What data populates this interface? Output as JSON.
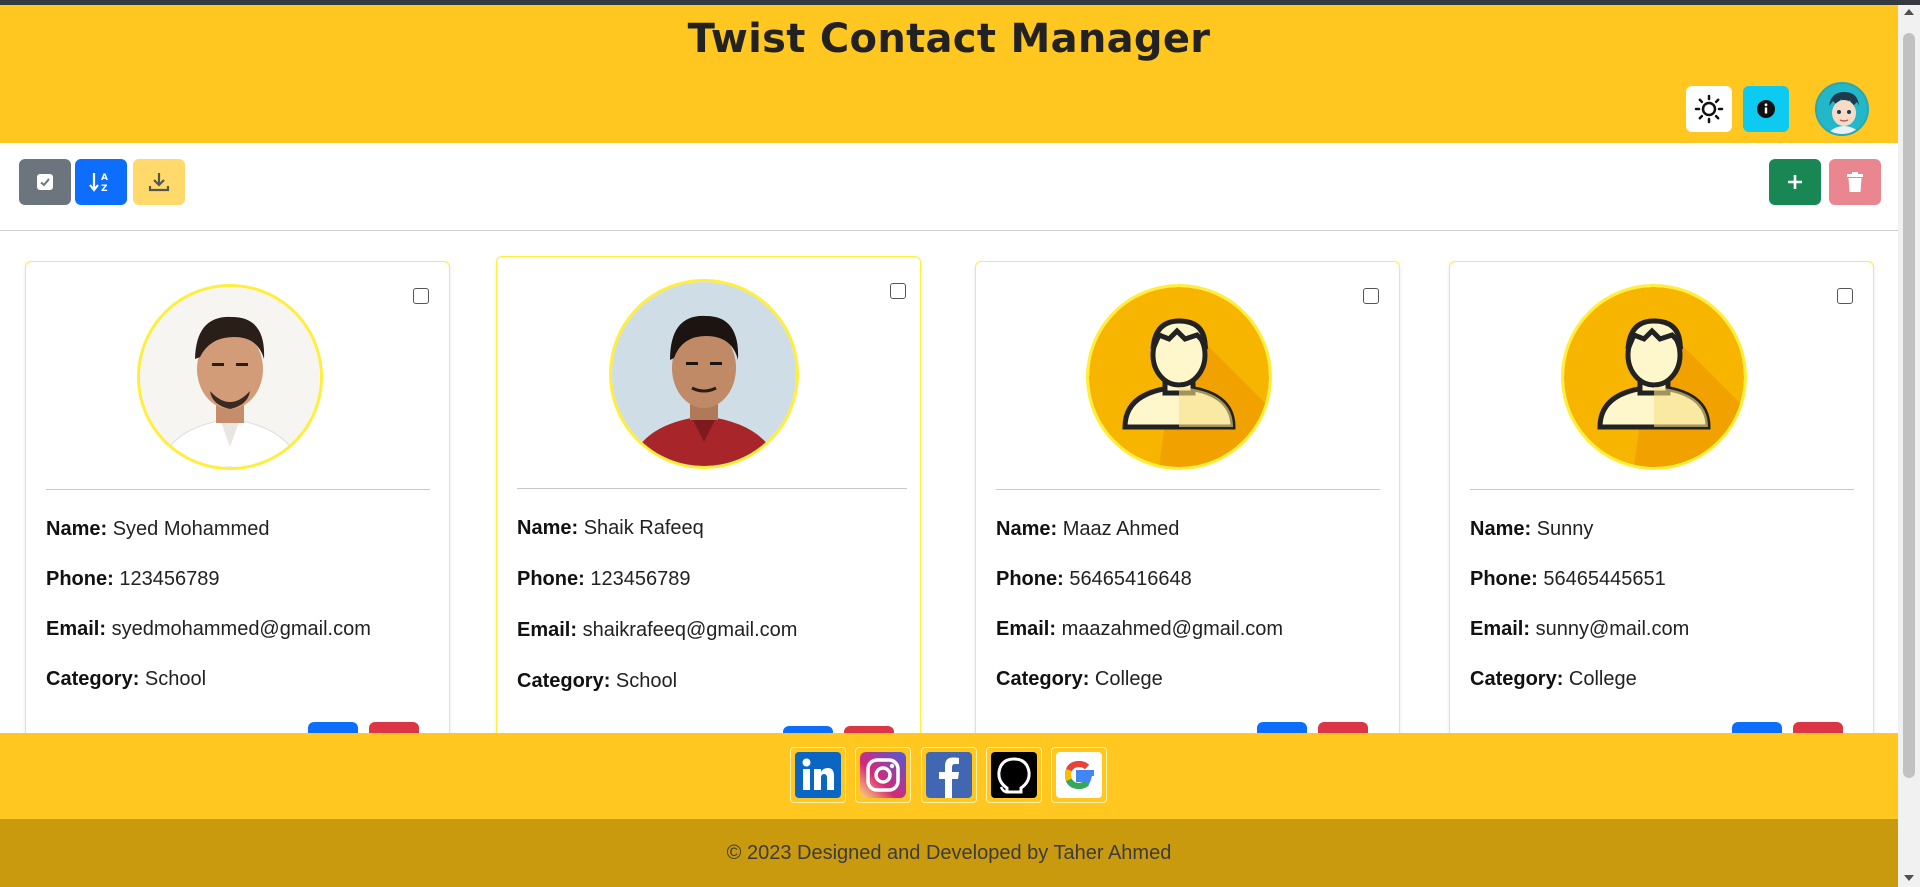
{
  "app": {
    "title": "Twist Contact Manager"
  },
  "nav": {
    "theme_icon": "sun-icon",
    "info_icon": "info-icon",
    "avatar_icon": "user-avatar"
  },
  "toolbar": {
    "select_icon": "check-square-icon",
    "sort_icon": "sort-alpha-icon",
    "download_icon": "download-icon",
    "add_icon": "plus-icon",
    "delete_icon": "trash-icon"
  },
  "labels": {
    "name": "Name:",
    "phone": "Phone:",
    "email": "Email:",
    "category": "Category:"
  },
  "contacts": [
    {
      "name": "Syed Mohammed",
      "phone": "123456789",
      "email": "syedmohammed@gmail.com",
      "category": "School",
      "photo": "person-photo"
    },
    {
      "name": "Shaik Rafeeq",
      "phone": "123456789",
      "email": "shaikrafeeq@gmail.com",
      "category": "School",
      "photo": "person-photo"
    },
    {
      "name": "Maaz Ahmed",
      "phone": "56465416648",
      "email": "maazahmed@gmail.com",
      "category": "College",
      "photo": "default-user-icon"
    },
    {
      "name": "Sunny",
      "phone": "56465445651",
      "email": "sunny@mail.com",
      "category": "College",
      "photo": "default-user-icon"
    }
  ],
  "footer": {
    "social": [
      "linkedin-icon",
      "instagram-icon",
      "facebook-icon",
      "github-icon",
      "google-icon"
    ],
    "copyright": "© 2023 Designed and Developed by Taher Ahmed"
  },
  "colors": {
    "header": "#ffc71f",
    "footer_dark": "#c99a0d",
    "card_border": "#ffee3a",
    "primary": "#0d6efd",
    "danger": "#dc3545",
    "success": "#198754"
  }
}
